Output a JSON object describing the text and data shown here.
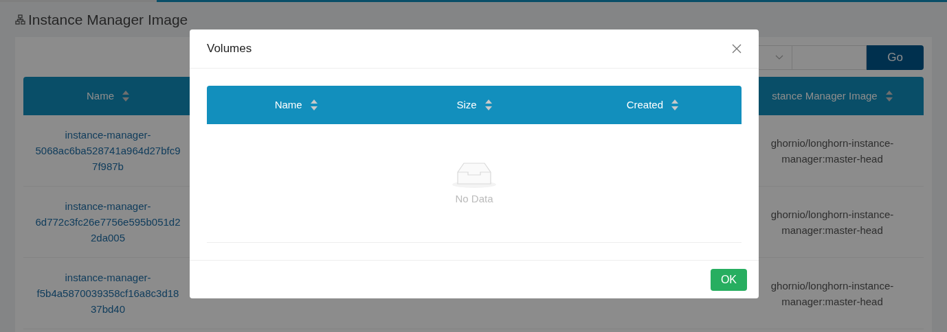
{
  "page": {
    "title": "Instance Manager Image",
    "go_button": "Go"
  },
  "table": {
    "columns": [
      {
        "label": "Name"
      },
      {
        "label": "stance Manager Image"
      }
    ],
    "rows": [
      {
        "name": "instance-manager-5068ac6ba528741a964d27bfc97f987b",
        "image": "ghornio/longhorn-instance-manager:master-head"
      },
      {
        "name": "instance-manager-6d772c3fc26e7756e595b051d22da005",
        "image": "ghornio/longhorn-instance-manager:master-head"
      },
      {
        "name": "instance-manager-f5b4a5870039358cf16a8c3d1837bd40",
        "image": "ghornio/longhorn-instance-manager:master-head"
      }
    ]
  },
  "modal": {
    "title": "Volumes",
    "columns": [
      "Name",
      "Size",
      "Created"
    ],
    "empty_text": "No Data",
    "ok_button": "OK"
  }
}
